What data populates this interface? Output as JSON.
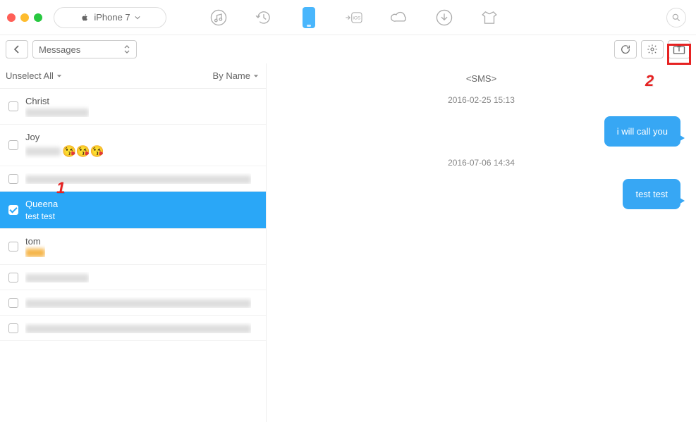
{
  "device": {
    "name": "iPhone 7"
  },
  "category": {
    "selected": "Messages"
  },
  "list_controls": {
    "select_action": "Unselect All",
    "sort": "By Name"
  },
  "conversations": [
    {
      "name": "Christ",
      "preview_blurred": true,
      "selected": false
    },
    {
      "name": "Joy",
      "preview_emoji": "😘😘😘",
      "selected": false
    },
    {
      "name": "",
      "name_blurred": true,
      "preview_blurred_long": true,
      "selected": false
    },
    {
      "name": "Queena",
      "preview": "test test",
      "selected": true
    },
    {
      "name": "tom",
      "preview_orange": true,
      "selected": false
    },
    {
      "name": "",
      "name_blurred": true,
      "preview_blurred": true,
      "selected": false
    },
    {
      "name": "",
      "name_blurred": true,
      "preview_blurred_long": true,
      "selected": false
    },
    {
      "name": "",
      "name_blurred": true,
      "preview_blurred_long": true,
      "selected": false
    }
  ],
  "thread": {
    "title": "<SMS>",
    "items": [
      {
        "type": "timestamp",
        "text": "2016-02-25 15:13"
      },
      {
        "type": "bubble",
        "text": "i will call you"
      },
      {
        "type": "timestamp",
        "text": "2016-07-06 14:34"
      },
      {
        "type": "bubble",
        "text": "test test"
      }
    ]
  },
  "annotations": {
    "step1": "1",
    "step2": "2"
  }
}
